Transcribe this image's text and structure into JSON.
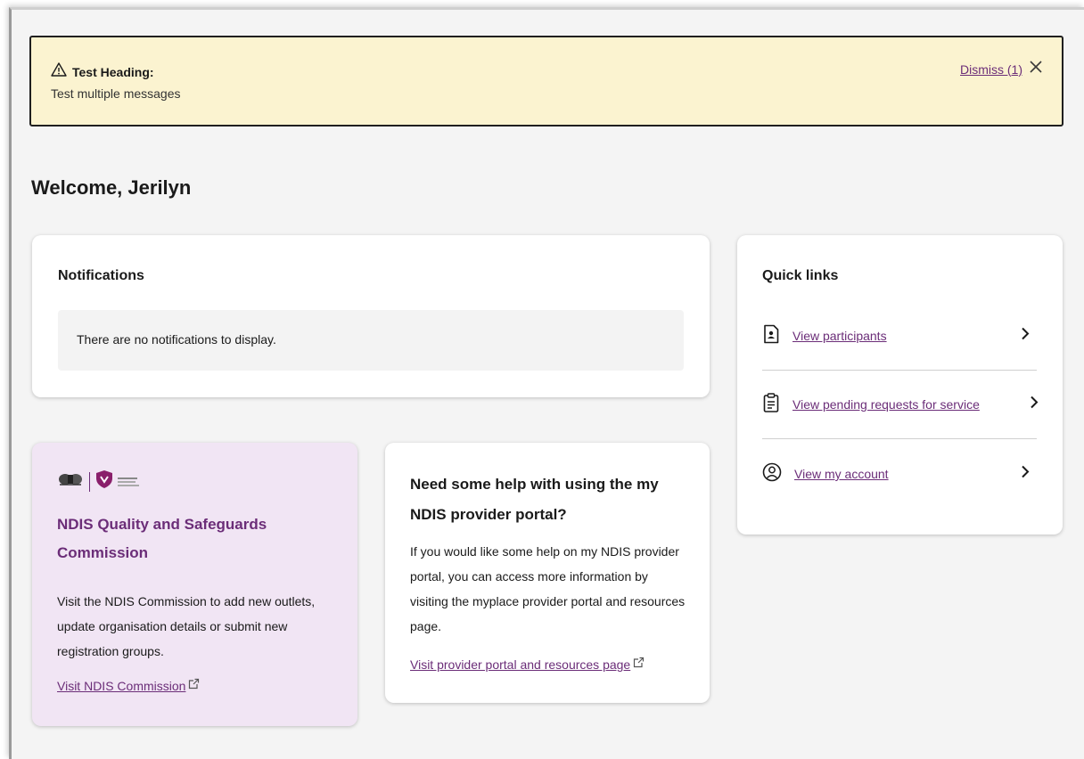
{
  "alert": {
    "heading": "Test Heading:",
    "message": "Test multiple messages",
    "dismiss_label": "Dismiss (1)"
  },
  "welcome": "Welcome, Jerilyn",
  "notifications": {
    "title": "Notifications",
    "empty_text": "There are no notifications to display."
  },
  "quick_links": {
    "title": "Quick links",
    "items": [
      {
        "label": "View participants",
        "icon": "participant-file-icon"
      },
      {
        "label": "View pending requests for service",
        "icon": "clipboard-icon"
      },
      {
        "label": "View my account",
        "icon": "user-circle-icon"
      }
    ]
  },
  "ndis_card": {
    "title": "NDIS Quality and Safeguards Commission",
    "body": "Visit the NDIS Commission to add new outlets, update organisation details or submit new registration groups.",
    "link": "Visit NDIS Commission",
    "logo_text": "NDIS Quality and Safeguards Commission"
  },
  "help_card": {
    "title": "Need some help with using the my NDIS provider portal?",
    "body": "If you would like some help on my NDIS provider portal, you can access more information by visiting the myplace provider portal and resources page.",
    "link": "Visit provider portal and resources page"
  },
  "colors": {
    "accent": "#6b2d78",
    "alert_bg": "#fbf3d0",
    "ndis_card_bg": "#f1e5f4"
  }
}
